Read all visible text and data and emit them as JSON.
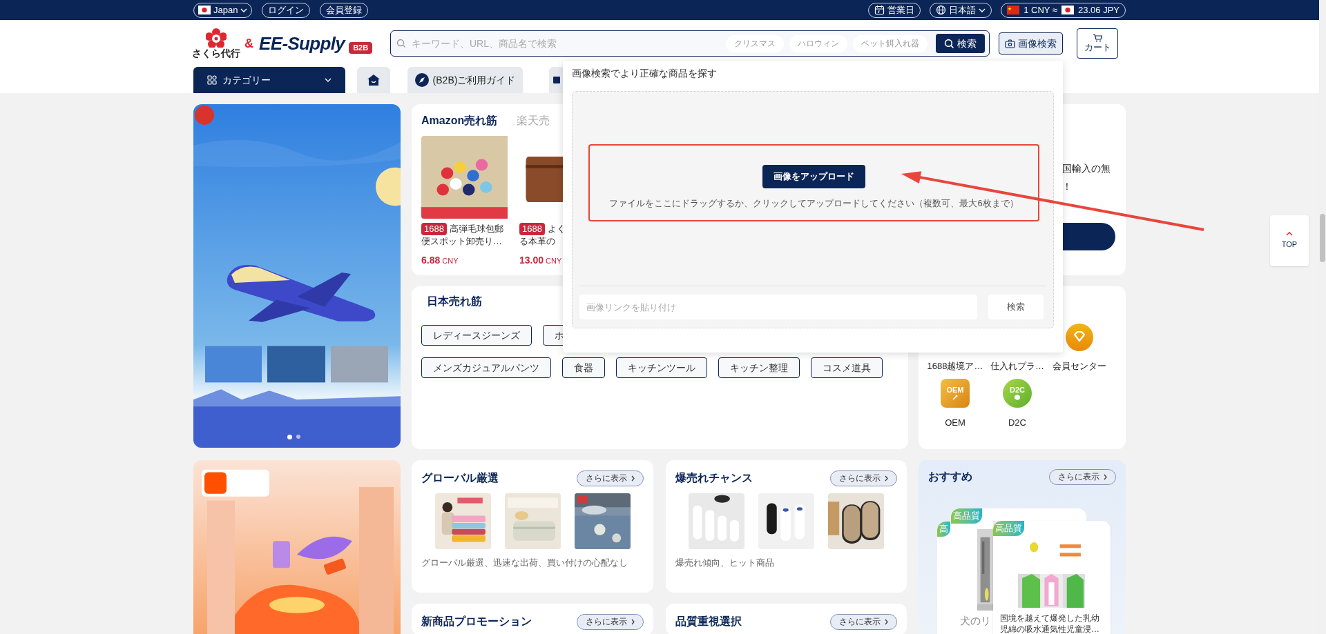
{
  "top_bar": {
    "region": "Japan",
    "login": "ログイン",
    "register": "会員登録",
    "business_days": "営業日",
    "language": "日本語",
    "rate_from": "1 CNY ≈",
    "rate_to": "23.06 JPY"
  },
  "logo": {
    "brand": "さくら代行",
    "amp": "&",
    "partner": "EE-Supply",
    "badge": "B2B"
  },
  "search": {
    "placeholder": "キーワード、URL、商品名で検索",
    "suggestions": [
      "クリスマス",
      "ハロウィン",
      "ペット餌入れ器"
    ],
    "button": "検索"
  },
  "image_search_button": "画像検索",
  "cart": "カート",
  "nav": [
    {
      "kind": "category",
      "label": "カテゴリー"
    },
    {
      "kind": "home"
    },
    {
      "kind": "guide",
      "label": "(B2B)ご利用ガイド"
    },
    {
      "kind": "partial"
    }
  ],
  "banner": {
    "dots": [
      {
        "selected": true
      },
      {
        "selected": false
      }
    ]
  },
  "ranking_card": {
    "tabs": [
      {
        "label": "Amazon売れ筋",
        "selected": true
      },
      {
        "label": "楽天売",
        "selected": false
      }
    ],
    "products": [
      {
        "source": "1688",
        "title_lines": [
          "高弾毛球包郵",
          "便スポット卸売り…"
        ],
        "price": "6.88",
        "currency": "CNY"
      },
      {
        "source": "1688",
        "title_lines": [
          "よく",
          "る本革の"
        ],
        "price": "13.00",
        "currency": "CNY"
      }
    ]
  },
  "japan_trending": {
    "title": "日本売れ筋",
    "tag_rows": [
      [
        "レディースジーンズ",
        "ホ"
      ],
      [
        "メンズカジュアルパンツ",
        "食器",
        "キッチンツール",
        "キッチン整理",
        "コスメ道具"
      ]
    ]
  },
  "promo_card": {
    "lines": [
      "国輸入の無",
      "！"
    ]
  },
  "services": [
    {
      "label": "1688越境ア…",
      "kind": "hidden"
    },
    {
      "label": "仕入れプラ…",
      "kind": "hidden"
    },
    {
      "label": "会員センター",
      "kind": "member"
    },
    {
      "label": "OEM",
      "kind": "oem",
      "badge": "OEM"
    },
    {
      "label": "D2C",
      "kind": "d2c",
      "badge": "D2C"
    }
  ],
  "image_search_popup": {
    "title": "画像検索でより正確な商品を探す",
    "upload_button": "画像をアップロード",
    "hint": "ファイルをここにドラッグするか、クリックしてアップロードしてください（複数可、最大6枚まで）",
    "link_placeholder": "画像リンクを貼り付け",
    "search_button": "検索"
  },
  "feature_cards": [
    {
      "title": "グローバル厳選",
      "more": "さらに表示",
      "description": "グローバル厳選、迅速な出荷、買い付けの心配なし"
    },
    {
      "title": "爆売れチャンス",
      "more": "さらに表示",
      "description": "爆売れ傾向、ヒット商品"
    },
    {
      "title": "新商品プロモーション",
      "more": "さらに表示"
    },
    {
      "title": "品質重視選択",
      "more": "さらに表示"
    }
  ],
  "recommend": {
    "title": "おすすめ",
    "more": "さらに表示",
    "cards": [
      {
        "badge": "高"
      },
      {
        "badge": "高品質",
        "caption": "犬のリ"
      },
      {
        "badge": "高品質",
        "caption": "国境を越えて爆発した乳幼児綿の吸水通気性児童浸…"
      }
    ]
  },
  "back_to_top": "TOP"
}
